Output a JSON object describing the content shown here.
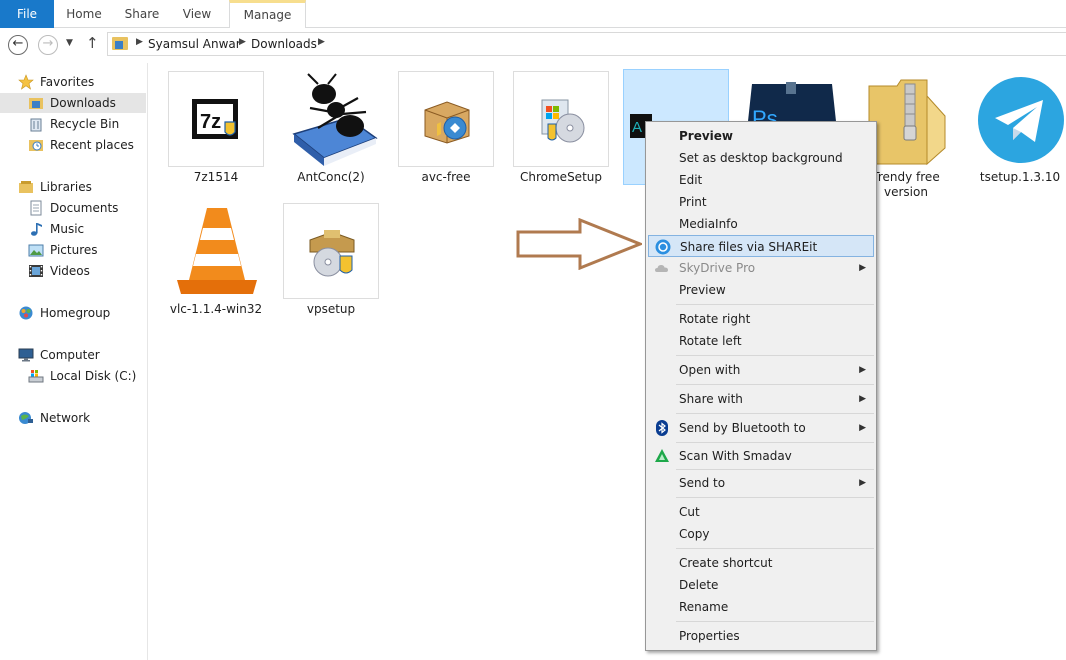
{
  "ribbon": {
    "tabs": [
      "File",
      "Home",
      "Share",
      "View",
      "Manage"
    ]
  },
  "address": {
    "crumbs": [
      "Syamsul Anwar",
      "Downloads"
    ]
  },
  "navpane": {
    "favorites": "Favorites",
    "downloads": "Downloads",
    "recycle_bin": "Recycle Bin",
    "recent_places": "Recent places",
    "libraries": "Libraries",
    "documents": "Documents",
    "music": "Music",
    "pictures": "Pictures",
    "videos": "Videos",
    "homegroup": "Homegroup",
    "computer": "Computer",
    "local_disk": "Local Disk (C:)",
    "network": "Network"
  },
  "files": [
    {
      "name": "7z1514",
      "icon": "7zip-installer-icon"
    },
    {
      "name": "AntConc(2)",
      "icon": "antconc-icon"
    },
    {
      "name": "avc-free",
      "icon": "installer-box-icon"
    },
    {
      "name": "ChromeSetup",
      "icon": "setup-cd-icon"
    },
    {
      "name": "",
      "icon": "selected-image-thumbnail"
    },
    {
      "name": "",
      "icon": "photoshop-icon"
    },
    {
      "name": "Trendy free version",
      "icon": "zip-folder-icon"
    },
    {
      "name": "tsetup.1.3.10",
      "icon": "telegram-icon"
    },
    {
      "name": "vlc-1.1.4-win32",
      "icon": "vlc-cone-icon"
    },
    {
      "name": "vpsetup",
      "icon": "setup-cd-icon"
    }
  ],
  "context_menu": {
    "preview_bold": "Preview",
    "set_desktop": "Set as desktop background",
    "edit": "Edit",
    "print": "Print",
    "mediainfo": "MediaInfo",
    "shareit": "Share files via SHAREit",
    "skydrive": "SkyDrive Pro",
    "preview": "Preview",
    "rotate_right": "Rotate right",
    "rotate_left": "Rotate left",
    "open_with": "Open with",
    "share_with": "Share with",
    "bluetooth": "Send by Bluetooth to",
    "smadav": "Scan With Smadav",
    "send_to": "Send to",
    "cut": "Cut",
    "copy": "Copy",
    "create_shortcut": "Create shortcut",
    "delete": "Delete",
    "rename": "Rename",
    "properties": "Properties"
  },
  "colors": {
    "file_tab": "#1979ca",
    "selection": "#cce8ff",
    "menu_highlight": "#d5e6f7",
    "arrow_annotation": "#b07a4f"
  }
}
